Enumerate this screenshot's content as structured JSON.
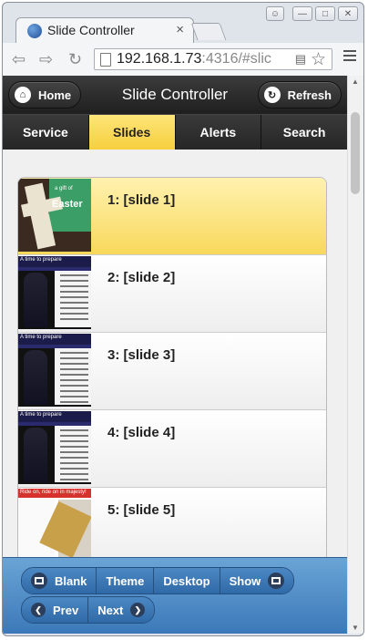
{
  "browser": {
    "tab_title": "Slide Controller",
    "tab_close": "×",
    "url_host": "192.168.1.73",
    "url_rest": ":4316/#slic",
    "window_buttons": [
      "—",
      "□",
      "✕"
    ]
  },
  "header": {
    "title": "Slide Controller",
    "home_label": "Home",
    "refresh_label": "Refresh"
  },
  "tabs": [
    {
      "label": "Service",
      "active": false
    },
    {
      "label": "Slides",
      "active": true
    },
    {
      "label": "Alerts",
      "active": false
    },
    {
      "label": "Search",
      "active": false
    }
  ],
  "slides": [
    {
      "label": "1: [slide 1]",
      "active": true,
      "thumb_text": "Easter",
      "thumb_pre": "a gift of"
    },
    {
      "label": "2: [slide 2]",
      "active": false,
      "thumb_text": "A time to prepare"
    },
    {
      "label": "3: [slide 3]",
      "active": false,
      "thumb_text": "A time to prepare"
    },
    {
      "label": "4: [slide 4]",
      "active": false,
      "thumb_text": "A time to prepare"
    },
    {
      "label": "5: [slide 5]",
      "active": false,
      "thumb_text": "Ride on, ride on in majesty!"
    }
  ],
  "footer": {
    "blank": "Blank",
    "theme": "Theme",
    "desktop": "Desktop",
    "show": "Show",
    "prev": "Prev",
    "next": "Next"
  },
  "colors": {
    "active_tab": "#f7cf3e",
    "footer_blue": "#3b78b8",
    "header_dark": "#1f1f1f"
  }
}
